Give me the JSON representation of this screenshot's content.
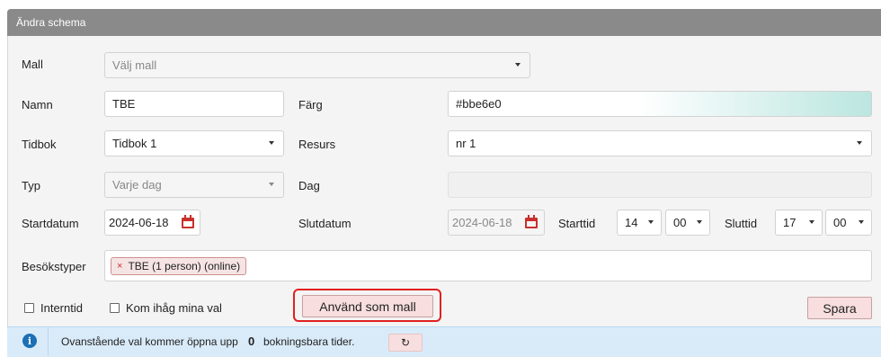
{
  "title": "Ändra schema",
  "labels": {
    "mall": "Mall",
    "namn": "Namn",
    "farg": "Färg",
    "tidbok": "Tidbok",
    "resurs": "Resurs",
    "typ": "Typ",
    "dag": "Dag",
    "startdatum": "Startdatum",
    "slutdatum": "Slutdatum",
    "starttid": "Starttid",
    "sluttid": "Sluttid",
    "besokstyper": "Besökstyper"
  },
  "fields": {
    "mall_placeholder": "Välj mall",
    "namn": "TBE",
    "farg": "#bbe6e0",
    "tidbok": "Tidbok 1",
    "resurs": "nr 1",
    "typ": "Varje dag",
    "dag": "",
    "startdatum": "2024-06-18",
    "slutdatum": "2024-06-18",
    "start_hour": "14",
    "start_min": "00",
    "end_hour": "17",
    "end_min": "00"
  },
  "besokstyper_tags": [
    "TBE (1 person) (online)"
  ],
  "checkboxes": {
    "interntid": "Interntid",
    "kom_ihag": "Kom ihåg mina val"
  },
  "buttons": {
    "anvand_som_mall": "Använd som mall",
    "spara": "Spara",
    "refresh": "↻"
  },
  "info": {
    "prefix": "Ovanstående val kommer öppna upp",
    "count": "0",
    "suffix": "bokningsbara tider.",
    "icon": "i"
  },
  "colors": {
    "swatch": "#bbe6e0",
    "titlebar": "#8a8a8a",
    "highlight": "#e02020",
    "info_bg": "#d9ebf9"
  }
}
